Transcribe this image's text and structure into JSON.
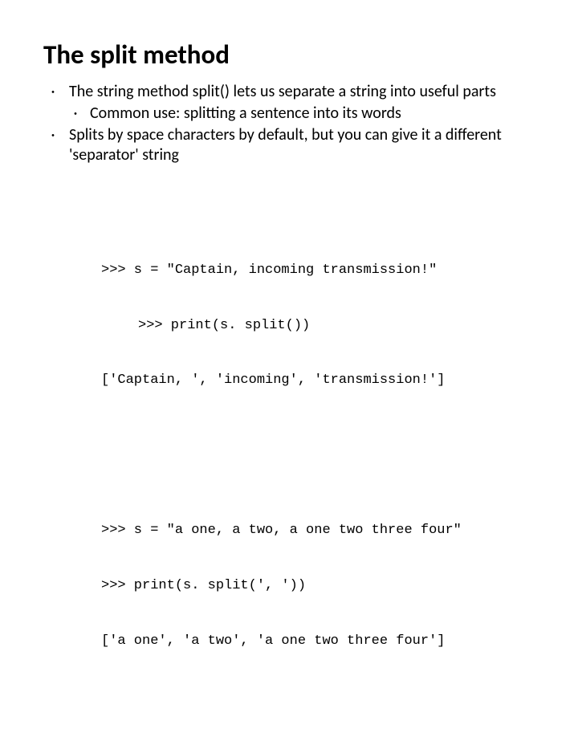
{
  "title": "The split method",
  "bullets": {
    "b1": "The string method split() lets us separate a string into useful parts",
    "b1a": "Common use: splitting a sentence into its words",
    "b2": "Splits by space characters by default, but you can give it a different 'separator' string"
  },
  "code1": {
    "l1": ">>> s = \"Captain, incoming transmission!\"",
    "l2": ">>> print(s. split())",
    "l3": "['Captain, ', 'incoming', 'transmission!']"
  },
  "code2": {
    "l1": ">>> s = \"a one, a two, a one two three four\"",
    "l2": ">>> print(s. split(', '))",
    "l3": "['a one', 'a two', 'a one two three four']"
  }
}
